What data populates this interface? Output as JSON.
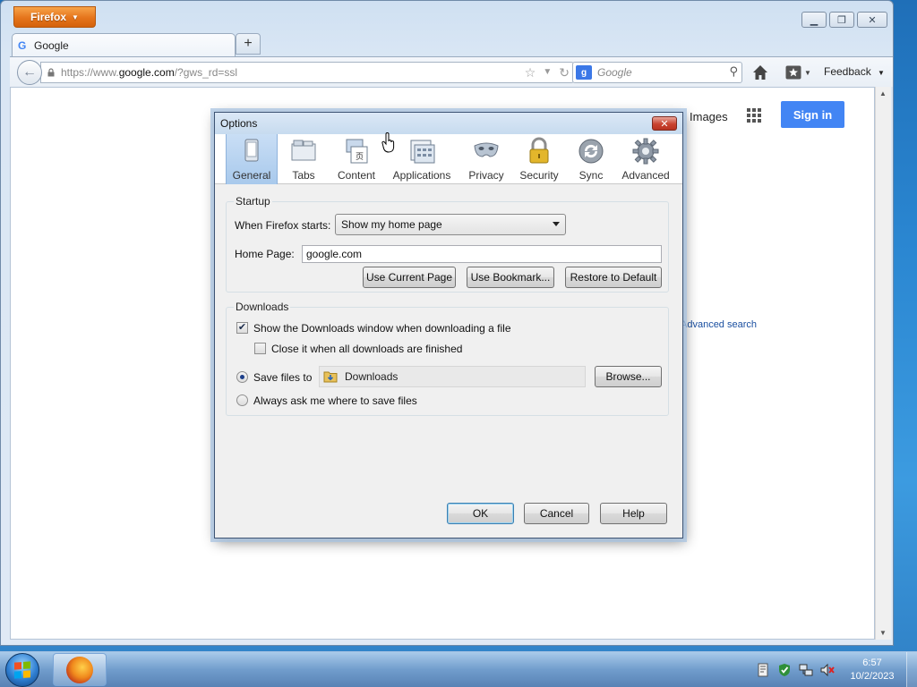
{
  "browser": {
    "menu_button": "Firefox",
    "tab_title": "Google",
    "url_prefix": "https://www.",
    "url_host": "google.com",
    "url_path": "/?gws_rd=ssl",
    "search_placeholder": "Google",
    "feedback_label": "Feedback"
  },
  "google": {
    "images_link": "Images",
    "sign_in": "Sign in",
    "advanced_search": "Advanced search"
  },
  "dialog": {
    "title": "Options",
    "panes": [
      {
        "label": "General",
        "icon": "general-icon"
      },
      {
        "label": "Tabs",
        "icon": "tabs-icon"
      },
      {
        "label": "Content",
        "icon": "content-icon"
      },
      {
        "label": "Applications",
        "icon": "applications-icon"
      },
      {
        "label": "Privacy",
        "icon": "privacy-icon"
      },
      {
        "label": "Security",
        "icon": "security-icon"
      },
      {
        "label": "Sync",
        "icon": "sync-icon"
      },
      {
        "label": "Advanced",
        "icon": "advanced-icon"
      }
    ],
    "selected_pane": "General",
    "startup": {
      "group_title": "Startup",
      "when_starts_label": "When Firefox starts:",
      "when_starts_value": "Show my home page",
      "home_page_label": "Home Page:",
      "home_page_value": "google.com",
      "use_current_page": "Use Current Page",
      "use_bookmark": "Use Bookmark...",
      "restore_default": "Restore to Default"
    },
    "downloads": {
      "group_title": "Downloads",
      "show_window_label": "Show the Downloads window when downloading a file",
      "show_window_checked": true,
      "close_it_label": "Close it when all downloads are finished",
      "close_it_checked": false,
      "save_files_label": "Save files to",
      "save_folder": "Downloads",
      "browse": "Browse...",
      "always_ask_label": "Always ask me where to save files",
      "selected_option": "save_files"
    },
    "buttons": {
      "ok": "OK",
      "cancel": "Cancel",
      "help": "Help"
    }
  },
  "taskbar": {
    "time": "6:57",
    "date": "10/2/2023"
  },
  "colors": {
    "firefox_orange": "#e5741b",
    "google_blue": "#4285f4",
    "pane_active": "#c9def5"
  }
}
